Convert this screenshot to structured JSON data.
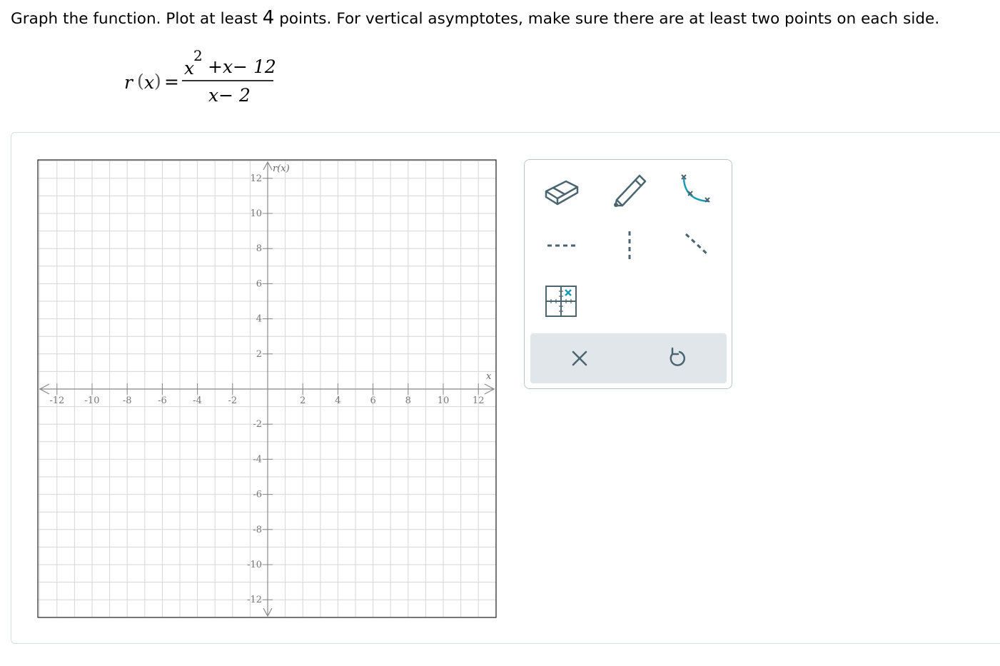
{
  "instruction": {
    "part1": "Graph the function. Plot at least ",
    "count": "4",
    "part2": " points. For vertical asymptotes, make sure there are at least two points on each side."
  },
  "formula": {
    "lhs_name": "r",
    "lhs_open": "(",
    "lhs_var": "x",
    "lhs_close": ")",
    "equals": "=",
    "num_var": "x",
    "num_exp": "2",
    "num_rest": "+x− 12",
    "den": "x− 2"
  },
  "graph": {
    "y_axis_label": "r(x)",
    "x_axis_label": "x",
    "x_range": [
      -13,
      13
    ],
    "y_range": [
      -13,
      13
    ],
    "x_ticks": [
      "-12",
      "-10",
      "-8",
      "-6",
      "-4",
      "-2",
      "2",
      "4",
      "6",
      "8",
      "10",
      "12"
    ],
    "y_ticks": [
      "12",
      "10",
      "8",
      "6",
      "4",
      "2",
      "-2",
      "-4",
      "-6",
      "-8",
      "-10",
      "-12"
    ],
    "grid": true
  },
  "toolbox": {
    "tools": [
      {
        "name": "eraser-tool",
        "icon": "eraser-icon"
      },
      {
        "name": "pencil-tool",
        "icon": "pencil-icon"
      },
      {
        "name": "curve-tool",
        "icon": "curve-icon"
      },
      {
        "name": "horizontal-asymptote-tool",
        "icon": "horizontal-dashed-line-icon"
      },
      {
        "name": "vertical-asymptote-tool",
        "icon": "vertical-dashed-line-icon"
      },
      {
        "name": "slant-asymptote-tool",
        "icon": "slant-dashed-line-icon"
      },
      {
        "name": "hole-point-tool",
        "icon": "grid-point-icon"
      }
    ],
    "actions": [
      {
        "name": "clear-button",
        "icon": "close-icon"
      },
      {
        "name": "undo-button",
        "icon": "undo-icon"
      }
    ],
    "colors": {
      "stroke": "#4a6570",
      "accent": "#1a9bb0",
      "action_bg": "#e0e6e9"
    }
  }
}
